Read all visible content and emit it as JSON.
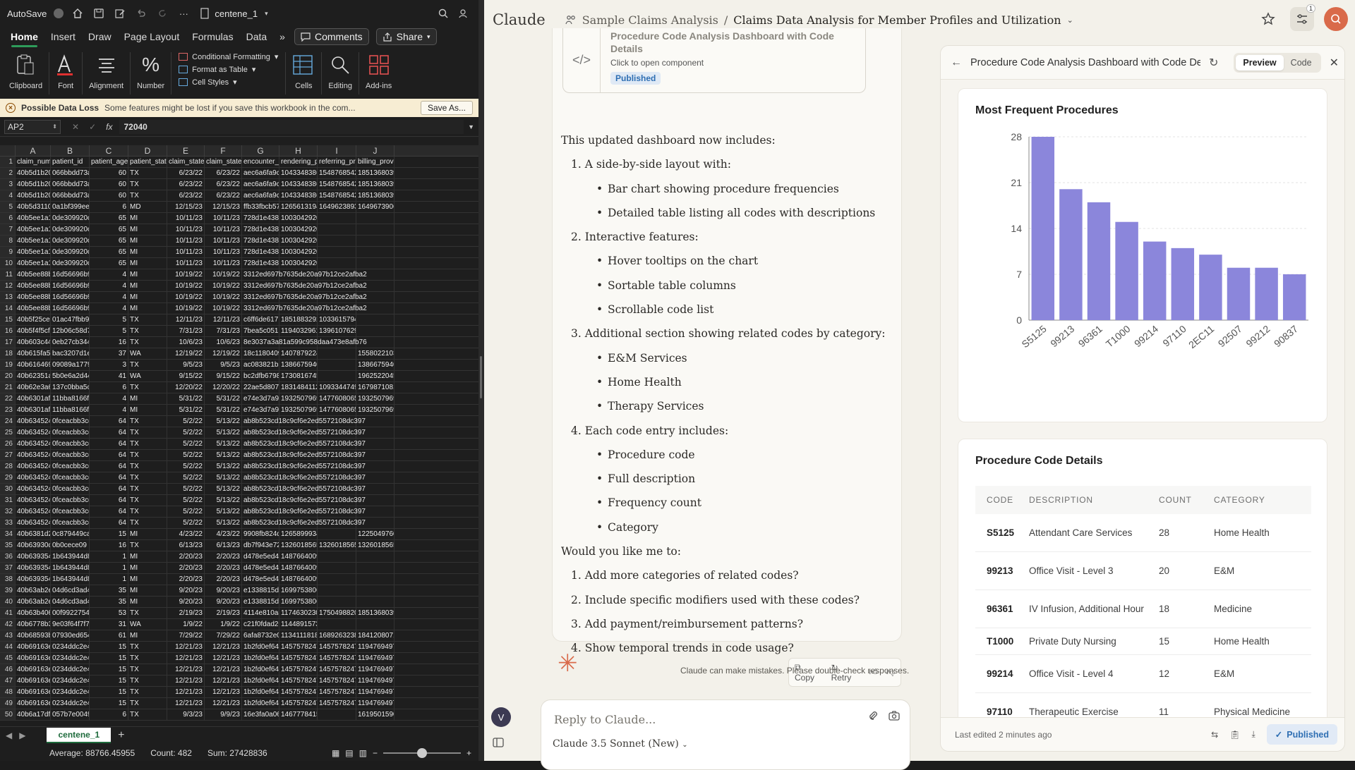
{
  "excel": {
    "title_bar": {
      "autosave_label": "AutoSave",
      "file_name": "centene_1"
    },
    "tabs": [
      "Home",
      "Insert",
      "Draw",
      "Page Layout",
      "Formulas",
      "Data"
    ],
    "tab_more": "»",
    "comments_label": "Comments",
    "share_label": "Share",
    "ribbon": {
      "clipboard": "Clipboard",
      "font": "Font",
      "alignment": "Alignment",
      "number": "Number",
      "conditional_formatting": "Conditional Formatting",
      "format_as_table": "Format as Table",
      "cell_styles": "Cell Styles",
      "cells": "Cells",
      "editing": "Editing",
      "addins": "Add-ins"
    },
    "warning": {
      "title": "Possible Data Loss",
      "message": "Some features might be lost if you save this workbook in the com...",
      "button": "Save As..."
    },
    "formula_bar": {
      "cell_ref": "AP2",
      "fx": "fx",
      "value": "72040"
    },
    "columns": [
      "A",
      "B",
      "C",
      "D",
      "E",
      "F",
      "G",
      "H",
      "I",
      "J"
    ],
    "header_row": [
      "claim_numbe",
      "patient_id",
      "patient_age",
      "patient_stat",
      "claim_staten",
      "claim_staten",
      "encounter_ic",
      "rendering_pr",
      "referring_pro",
      "billing_provic"
    ],
    "rows": [
      [
        "40b5d1b20d",
        "066bbdd73a",
        "60",
        "TX",
        "6/23/22",
        "6/23/22",
        "aec6a6fa9c3",
        "1043348386",
        "1548768542",
        "1851368039"
      ],
      [
        "40b5d1b20d",
        "066bbdd73a",
        "60",
        "TX",
        "6/23/22",
        "6/23/22",
        "aec6a6fa9c3",
        "1043348386",
        "1548768542",
        "1851368039"
      ],
      [
        "40b5d1b20d",
        "066bbdd73a",
        "60",
        "TX",
        "6/23/22",
        "6/23/22",
        "aec6a6fa9c3",
        "1043348386",
        "1548768542",
        "1851368039"
      ],
      [
        "40b5d31109",
        "0a1bf399ee1",
        "6",
        "MD",
        "12/15/23",
        "12/15/23",
        "ffb33fbcb57",
        "1265613194",
        "1649623893",
        "1649673906"
      ],
      [
        "40b5ee1a1f9",
        "0de309920c",
        "65",
        "MI",
        "10/11/23",
        "10/11/23",
        "728d1e4380",
        "1003042920",
        "",
        ""
      ],
      [
        "40b5ee1a1f9",
        "0de309920c",
        "65",
        "MI",
        "10/11/23",
        "10/11/23",
        "728d1e4380",
        "1003042920",
        "",
        ""
      ],
      [
        "40b5ee1a1f9",
        "0de309920c",
        "65",
        "MI",
        "10/11/23",
        "10/11/23",
        "728d1e4380",
        "1003042920",
        "",
        ""
      ],
      [
        "40b5ee1a1f9",
        "0de309920c",
        "65",
        "MI",
        "10/11/23",
        "10/11/23",
        "728d1e4380",
        "1003042920",
        "",
        ""
      ],
      [
        "40b5ee1a1f9",
        "0de309920c",
        "65",
        "MI",
        "10/11/23",
        "10/11/23",
        "728d1e4380",
        "1003042920",
        "",
        ""
      ],
      [
        "40b5ee88bel",
        "16d56696b9",
        "4",
        "MI",
        "10/19/22",
        "10/19/22",
        "3312ed697b7635de20a97b12ce2afba2",
        "",
        "",
        ""
      ],
      [
        "40b5ee88bel",
        "16d56696b9",
        "4",
        "MI",
        "10/19/22",
        "10/19/22",
        "3312ed697b7635de20a97b12ce2afba2",
        "",
        "",
        ""
      ],
      [
        "40b5ee88bel",
        "16d56696b9",
        "4",
        "MI",
        "10/19/22",
        "10/19/22",
        "3312ed697b7635de20a97b12ce2afba2",
        "",
        "",
        ""
      ],
      [
        "40b5ee88bel",
        "16d56696b9",
        "4",
        "MI",
        "10/19/22",
        "10/19/22",
        "3312ed697b7635de20a97b12ce2afba2",
        "",
        "",
        ""
      ],
      [
        "40b5f25ce90",
        "01ac47fbb95",
        "5",
        "TX",
        "12/11/23",
        "12/11/23",
        "c6ff6de6171",
        "1851883292",
        "1033615794",
        ""
      ],
      [
        "40b5f4f5cf79",
        "12b06c58d7",
        "5",
        "TX",
        "7/31/23",
        "7/31/23",
        "7bea5c0513",
        "1194032961",
        "1396107629",
        ""
      ],
      [
        "40b603c44bi",
        "0eb27cb344",
        "16",
        "TX",
        "10/6/23",
        "10/6/23",
        "8e3037a3a81a599c958daa473e8afb76",
        "",
        "",
        ""
      ],
      [
        "40b615fa59b",
        "bac3207d1e",
        "37",
        "WA",
        "12/19/22",
        "12/19/22",
        "18c1180409",
        "1407879224",
        "",
        "1558022103"
      ],
      [
        "40b61646961",
        "09089a1779",
        "3",
        "TX",
        "9/5/23",
        "9/5/23",
        "ac083821ba",
        "1386675940",
        "",
        "1386675940"
      ],
      [
        "40b62351a71",
        "5b0e6a2d44",
        "41",
        "WA",
        "9/15/22",
        "9/15/22",
        "bc2dfb67985",
        "1730816745",
        "",
        "1962522045"
      ],
      [
        "40b62e3a60",
        "137c0bba5c",
        "6",
        "TX",
        "12/20/22",
        "12/20/22",
        "22ae5d8075",
        "1831484112",
        "1093344749",
        "1679871081"
      ],
      [
        "40b6301afb0",
        "11bba8166f",
        "4",
        "MI",
        "5/31/22",
        "5/31/22",
        "e74e3d7a9e",
        "1932507969",
        "1477608065",
        "1932507969"
      ],
      [
        "40b6301afb0",
        "11bba8166f",
        "4",
        "MI",
        "5/31/22",
        "5/31/22",
        "e74e3d7a9e",
        "1932507969",
        "1477608065",
        "1932507969"
      ],
      [
        "40b634524d",
        "0fceacbb3cd",
        "64",
        "TX",
        "5/2/22",
        "5/13/22",
        "ab8b523cd18c9cf6e2ed5572108dc397",
        "",
        "",
        ""
      ],
      [
        "40b634524d",
        "0fceacbb3cd",
        "64",
        "TX",
        "5/2/22",
        "5/13/22",
        "ab8b523cd18c9cf6e2ed5572108dc397",
        "",
        "",
        ""
      ],
      [
        "40b634524d",
        "0fceacbb3cd",
        "64",
        "TX",
        "5/2/22",
        "5/13/22",
        "ab8b523cd18c9cf6e2ed5572108dc397",
        "",
        "",
        ""
      ],
      [
        "40b634524d",
        "0fceacbb3cd",
        "64",
        "TX",
        "5/2/22",
        "5/13/22",
        "ab8b523cd18c9cf6e2ed5572108dc397",
        "",
        "",
        ""
      ],
      [
        "40b634524d",
        "0fceacbb3cd",
        "64",
        "TX",
        "5/2/22",
        "5/13/22",
        "ab8b523cd18c9cf6e2ed5572108dc397",
        "",
        "",
        ""
      ],
      [
        "40b634524d",
        "0fceacbb3cd",
        "64",
        "TX",
        "5/2/22",
        "5/13/22",
        "ab8b523cd18c9cf6e2ed5572108dc397",
        "",
        "",
        ""
      ],
      [
        "40b634524d",
        "0fceacbb3cd",
        "64",
        "TX",
        "5/2/22",
        "5/13/22",
        "ab8b523cd18c9cf6e2ed5572108dc397",
        "",
        "",
        ""
      ],
      [
        "40b634524d",
        "0fceacbb3cd",
        "64",
        "TX",
        "5/2/22",
        "5/13/22",
        "ab8b523cd18c9cf6e2ed5572108dc397",
        "",
        "",
        ""
      ],
      [
        "40b634524d",
        "0fceacbb3cd",
        "64",
        "TX",
        "5/2/22",
        "5/13/22",
        "ab8b523cd18c9cf6e2ed5572108dc397",
        "",
        "",
        ""
      ],
      [
        "40b634524d",
        "0fceacbb3cd",
        "64",
        "TX",
        "5/2/22",
        "5/13/22",
        "ab8b523cd18c9cf6e2ed5572108dc397",
        "",
        "",
        ""
      ],
      [
        "40b6381d24",
        "0c879449ca",
        "15",
        "MI",
        "4/23/22",
        "4/23/22",
        "9908fb824df",
        "1265899934",
        "",
        "1225049760"
      ],
      [
        "40b63930d5",
        "0b0cece09",
        "16",
        "TX",
        "6/13/23",
        "6/13/23",
        "db7f943e72a",
        "1326018565",
        "1326018565",
        "1326018565"
      ],
      [
        "40b639354d",
        "1b643944d8",
        "1",
        "MI",
        "2/20/23",
        "2/20/23",
        "d478e5ed4e",
        "1487664009",
        "",
        ""
      ],
      [
        "40b639354d",
        "1b643944d8",
        "1",
        "MI",
        "2/20/23",
        "2/20/23",
        "d478e5ed4e",
        "1487664009",
        "",
        ""
      ],
      [
        "40b639354d",
        "1b643944d8",
        "1",
        "MI",
        "2/20/23",
        "2/20/23",
        "d478e5ed4e",
        "1487664009",
        "",
        ""
      ],
      [
        "40b63ab2e7",
        "04d6cd3ad4",
        "35",
        "MI",
        "9/20/23",
        "9/20/23",
        "e1338815dd",
        "1699753806",
        "",
        ""
      ],
      [
        "40b63ab2e7",
        "04d6cd3ad4",
        "35",
        "MI",
        "9/20/23",
        "9/20/23",
        "e1338815dd",
        "1699753806",
        "",
        ""
      ],
      [
        "40b63b4068",
        "00f99227544",
        "53",
        "TX",
        "2/19/23",
        "2/19/23",
        "4114e810a8",
        "1174630230",
        "1750498820",
        "1851368039"
      ],
      [
        "40b6778b3b",
        "9e03f64f7f7",
        "31",
        "WA",
        "1/9/22",
        "1/9/22",
        "c21f0fdad20",
        "1144891573",
        "",
        ""
      ],
      [
        "40b68593b2",
        "07930ed654",
        "61",
        "MI",
        "7/29/22",
        "7/29/22",
        "6afa8732e0",
        "1134111818",
        "1689263238",
        "1841208071"
      ],
      [
        "40b69163e8",
        "0234ddc2e4",
        "15",
        "TX",
        "12/21/23",
        "12/21/23",
        "1b2fd0ef648",
        "1457578247",
        "1457578247",
        "1194769497"
      ],
      [
        "40b69163e8",
        "0234ddc2e4",
        "15",
        "TX",
        "12/21/23",
        "12/21/23",
        "1b2fd0ef648",
        "1457578247",
        "1457578247",
        "1194769497"
      ],
      [
        "40b69163e8",
        "0234ddc2e4",
        "15",
        "TX",
        "12/21/23",
        "12/21/23",
        "1b2fd0ef648",
        "1457578247",
        "1457578247",
        "1194769497"
      ],
      [
        "40b69163e8",
        "0234ddc2e4",
        "15",
        "TX",
        "12/21/23",
        "12/21/23",
        "1b2fd0ef648",
        "1457578247",
        "1457578247",
        "1194769497"
      ],
      [
        "40b69163e8",
        "0234ddc2e4",
        "15",
        "TX",
        "12/21/23",
        "12/21/23",
        "1b2fd0ef648",
        "1457578247",
        "1457578247",
        "1194769497"
      ],
      [
        "40b69163e8",
        "0234ddc2e4",
        "15",
        "TX",
        "12/21/23",
        "12/21/23",
        "1b2fd0ef648",
        "1457578247",
        "1457578247",
        "1194769497"
      ],
      [
        "40b6a17dfbc",
        "057b7e0049",
        "6",
        "TX",
        "9/3/23",
        "9/9/23",
        "16e3fa0a06c",
        "1467778415",
        "",
        "1619501590"
      ]
    ],
    "sheet_tab": "centene_1",
    "status": {
      "average": "Average: 88766.45955",
      "count": "Count: 482",
      "sum": "Sum: 27428836"
    }
  },
  "claude": {
    "logo": "Claude",
    "project": "Sample Claims Analysis",
    "separator": "/",
    "chat_title": "Claims Data Analysis for Member Profiles and Utilization",
    "notif_count": "1",
    "artifact_card": {
      "title": "Procedure Code Analysis Dashboard with Code Details",
      "subtitle": "Click to open component",
      "status": "Published"
    },
    "message": [
      {
        "k": "p",
        "t": "This updated dashboard now includes:"
      },
      {
        "k": "li1",
        "t": "1. A side-by-side layout with:"
      },
      {
        "k": "li2",
        "t": "Bar chart showing procedure frequencies"
      },
      {
        "k": "li2",
        "t": "Detailed table listing all codes with descriptions"
      },
      {
        "k": "li1",
        "t": "2. Interactive features:"
      },
      {
        "k": "li2",
        "t": "Hover tooltips on the chart"
      },
      {
        "k": "li2",
        "t": "Sortable table columns"
      },
      {
        "k": "li2",
        "t": "Scrollable code list"
      },
      {
        "k": "li1",
        "t": "3. Additional section showing related codes by category:"
      },
      {
        "k": "li2",
        "t": "E&M Services"
      },
      {
        "k": "li2",
        "t": "Home Health"
      },
      {
        "k": "li2",
        "t": "Therapy Services"
      },
      {
        "k": "li1",
        "t": "4. Each code entry includes:"
      },
      {
        "k": "li2",
        "t": "Procedure code"
      },
      {
        "k": "li2",
        "t": "Full description"
      },
      {
        "k": "li2",
        "t": "Frequency count"
      },
      {
        "k": "li2",
        "t": "Category"
      },
      {
        "k": "p",
        "t": "Would you like me to:"
      },
      {
        "k": "li1",
        "t": "1. Add more categories of related codes?"
      },
      {
        "k": "li1",
        "t": "2. Include specific modifiers used with these codes?"
      },
      {
        "k": "li1",
        "t": "3. Add payment/reimbursement patterns?"
      },
      {
        "k": "li1",
        "t": "4. Show temporal trends in code usage?"
      }
    ],
    "actions": {
      "copy": "Copy",
      "retry": "Retry"
    },
    "disclaimer": "Claude can make mistakes. Please double-check responses.",
    "input": {
      "placeholder": "Reply to Claude...",
      "model": "Claude 3.5 Sonnet (New)"
    },
    "user_initial": "V",
    "panel": {
      "title": "Procedure Code Analysis Dashboard with Code De...",
      "preview": "Preview",
      "code": "Code",
      "chart_title": "Most Frequent Procedures",
      "table_title": "Procedure Code Details",
      "columns": [
        "CODE",
        "DESCRIPTION",
        "COUNT",
        "CATEGORY"
      ],
      "rows": [
        {
          "code": "S5125",
          "desc": "Attendant Care Services",
          "count": "28",
          "cat": "Home Health"
        },
        {
          "code": "99213",
          "desc": "Office Visit - Level 3",
          "count": "20",
          "cat": "E&M"
        },
        {
          "code": "96361",
          "desc": "IV Infusion, Additional Hour",
          "count": "18",
          "cat": "Medicine"
        },
        {
          "code": "T1000",
          "desc": "Private Duty Nursing",
          "count": "15",
          "cat": "Home Health"
        },
        {
          "code": "99214",
          "desc": "Office Visit - Level 4",
          "count": "12",
          "cat": "E&M"
        },
        {
          "code": "97110",
          "desc": "Therapeutic Exercise",
          "count": "11",
          "cat": "Physical Medicine"
        }
      ],
      "last_edited": "Last edited 2 minutes ago",
      "published": "Published"
    }
  },
  "chart_data": {
    "type": "bar",
    "title": "Most Frequent Procedures",
    "categories": [
      "S5125",
      "99213",
      "96361",
      "T1000",
      "99214",
      "97110",
      "2EC11",
      "92507",
      "99212",
      "90837"
    ],
    "values": [
      28,
      20,
      18,
      15,
      12,
      11,
      10,
      8,
      8,
      7
    ],
    "yticks": [
      0,
      7,
      14,
      21,
      28
    ],
    "ylim": [
      0,
      28
    ],
    "grid": true,
    "bar_color": "#8b86db"
  }
}
